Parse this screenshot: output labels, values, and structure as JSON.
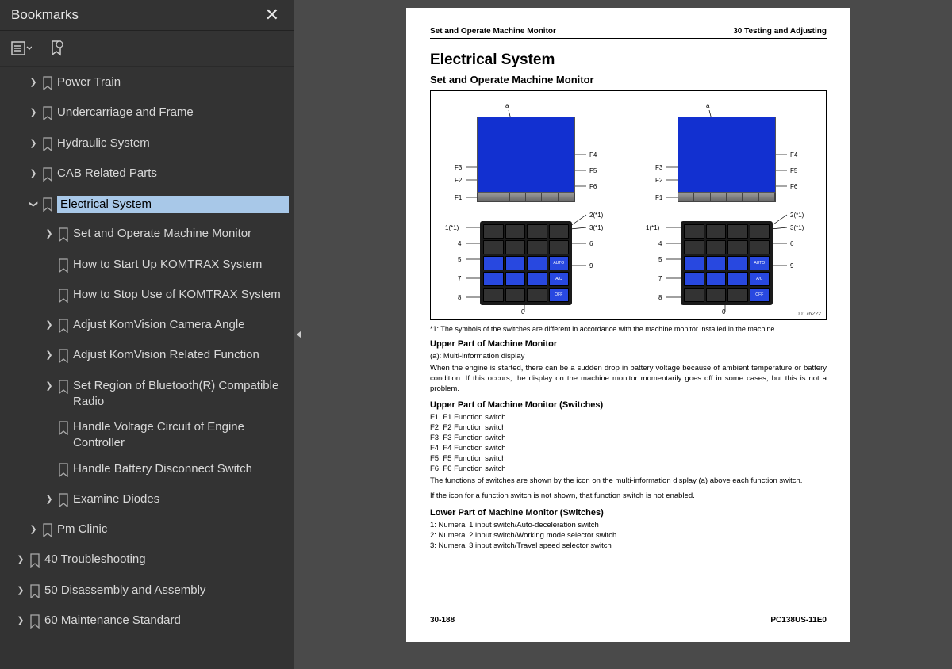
{
  "sidebar": {
    "title": "Bookmarks",
    "items": [
      {
        "indent": 1,
        "chev": "r",
        "label": "Power Train"
      },
      {
        "indent": 1,
        "chev": "r",
        "label": "Undercarriage and Frame"
      },
      {
        "indent": 1,
        "chev": "r",
        "label": "Hydraulic System"
      },
      {
        "indent": 1,
        "chev": "r",
        "label": "CAB Related Parts"
      },
      {
        "indent": 1,
        "chev": "d",
        "label": "Electrical System",
        "selected": true
      },
      {
        "indent": 2,
        "chev": "r",
        "label": "Set and Operate Machine Monitor"
      },
      {
        "indent": 2,
        "chev": "",
        "label": "How to Start Up KOMTRAX System"
      },
      {
        "indent": 2,
        "chev": "",
        "label": "How to Stop Use of KOMTRAX System"
      },
      {
        "indent": 2,
        "chev": "r",
        "label": "Adjust KomVision Camera Angle"
      },
      {
        "indent": 2,
        "chev": "r",
        "label": "Adjust KomVision Related Function"
      },
      {
        "indent": 2,
        "chev": "r",
        "label": "Set Region of Bluetooth(R) Compatible Radio"
      },
      {
        "indent": 2,
        "chev": "",
        "label": "Handle Voltage Circuit of Engine Controller"
      },
      {
        "indent": 2,
        "chev": "",
        "label": "Handle Battery Disconnect Switch"
      },
      {
        "indent": 2,
        "chev": "r",
        "label": "Examine Diodes"
      },
      {
        "indent": 1,
        "chev": "r",
        "label": "Pm Clinic"
      },
      {
        "indent": 0,
        "chev": "r",
        "label": "40 Troubleshooting"
      },
      {
        "indent": 0,
        "chev": "r",
        "label": "50 Disassembly and Assembly"
      },
      {
        "indent": 0,
        "chev": "r",
        "label": "60 Maintenance Standard"
      }
    ]
  },
  "page": {
    "header_left": "Set and Operate Machine Monitor",
    "header_right": "30 Testing and Adjusting",
    "h1": "Electrical System",
    "h2": "Set and Operate Machine Monitor",
    "fig_id": "00176222",
    "callouts": {
      "a": "a",
      "f1": "F1",
      "f2": "F2",
      "f3": "F3",
      "f4": "F4",
      "f5": "F5",
      "f6": "F6",
      "n1": "1(*1)",
      "n2": "2(*1)",
      "n3": "3(*1)",
      "n4": "4",
      "n5": "5",
      "n6": "6",
      "n7": "7",
      "n8": "8",
      "n9": "9",
      "n0": "0"
    },
    "key_labels": {
      "auto": "AUTO",
      "ac": "A/C",
      "off": "OFF"
    },
    "note1": "*1: The symbols of the switches are different in accordance with the machine monitor installed in the machine.",
    "h3a": "Upper Part of Machine Monitor",
    "sub_a": "(a): Multi-information display",
    "para_a": "When the engine is started, there can be a sudden drop in battery voltage because of ambient temperature or battery condition. If this occurs, the display on the machine monitor momentarily goes off in some cases, but this is not a problem.",
    "h3b": "Upper Part of Machine Monitor (Switches)",
    "f_list": [
      "F1: F1 Function switch",
      "F2: F2 Function switch",
      "F3: F3 Function switch",
      "F4: F4 Function switch",
      "F5: F5 Function switch",
      "F6: F6 Function switch"
    ],
    "para_b1": "The functions of switches are shown by the icon on the multi-information display (a) above each function switch.",
    "para_b2": "If the icon for a function switch is not shown, that function switch is not enabled.",
    "h3c": "Lower Part of Machine Monitor (Switches)",
    "n_list": [
      "1: Numeral 1 input switch/Auto-deceleration switch",
      "2: Numeral 2 input switch/Working mode selector switch",
      "3: Numeral 3 input switch/Travel speed selector switch"
    ],
    "footer_left": "30-188",
    "footer_right": "PC138US-11E0"
  }
}
